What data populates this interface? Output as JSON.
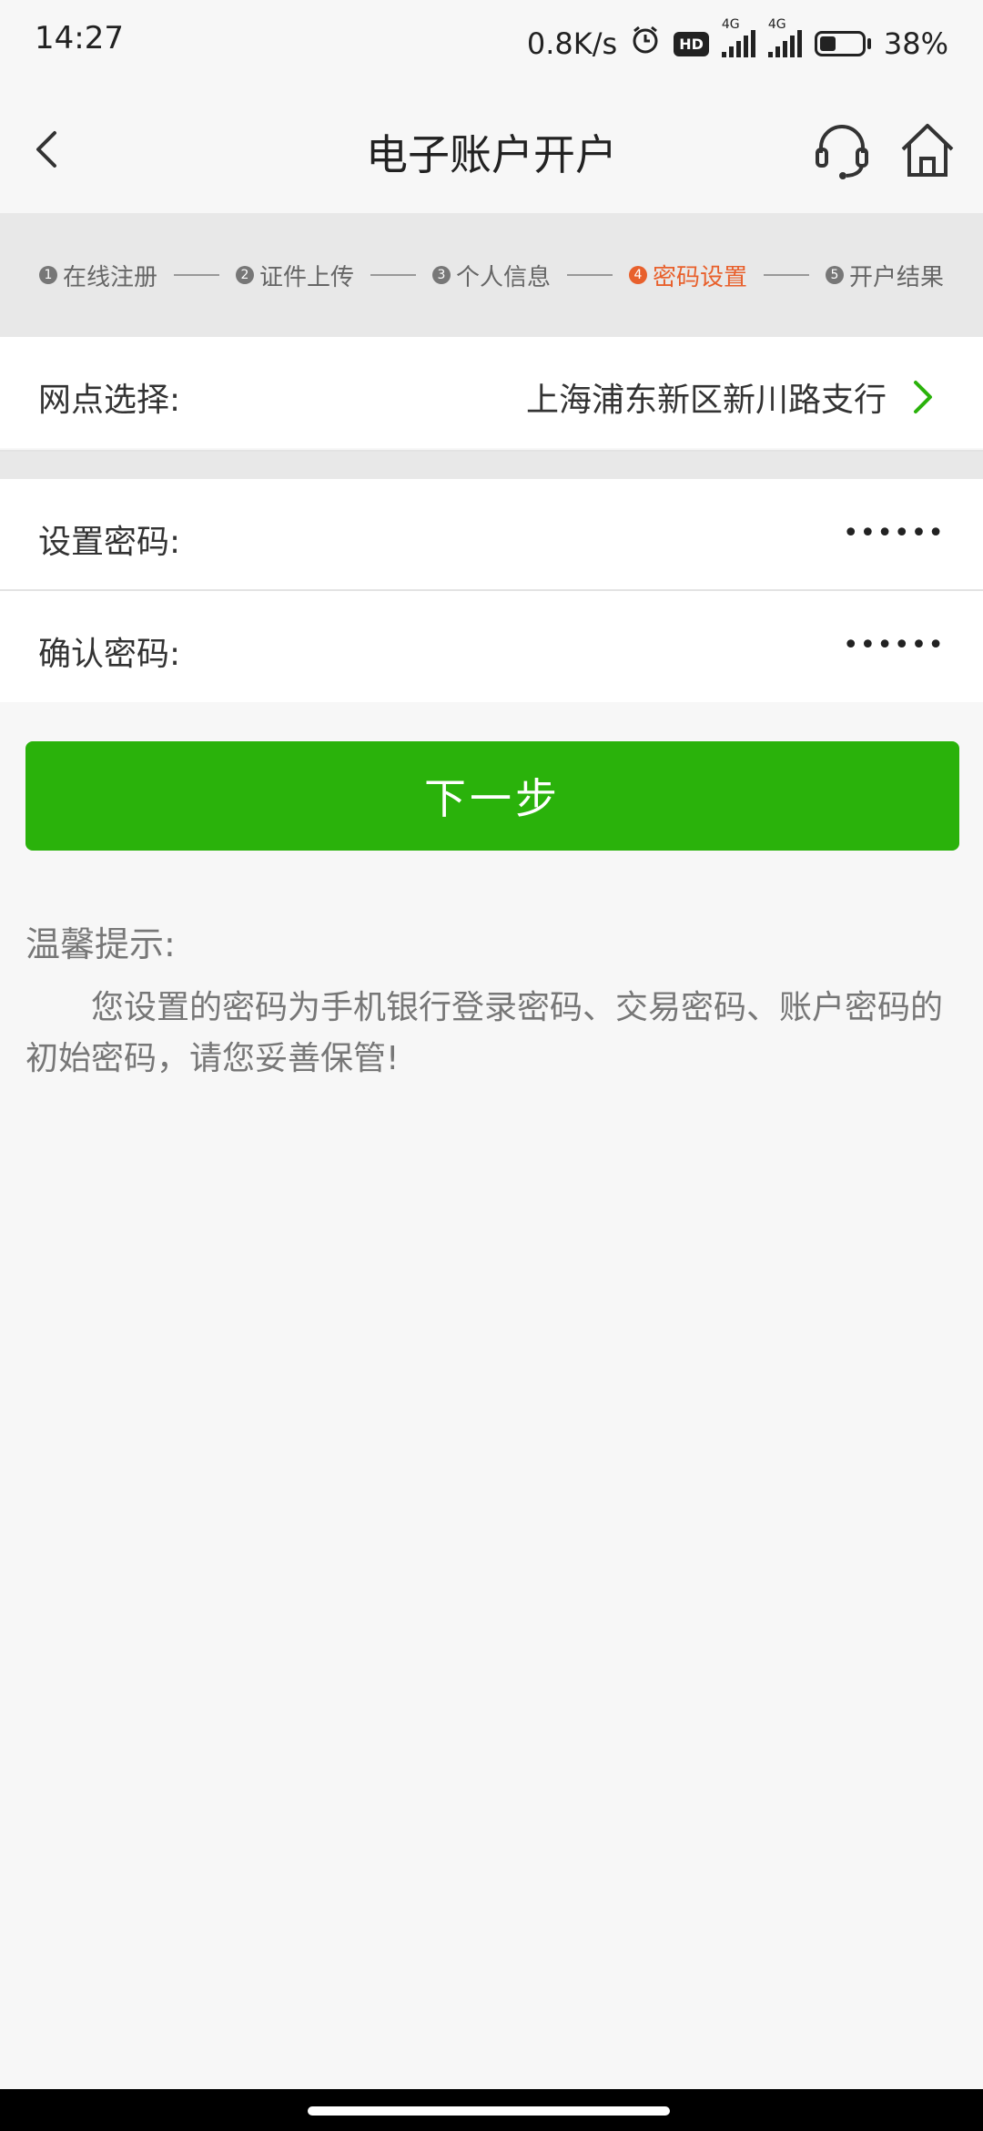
{
  "status_bar": {
    "time": "14:27",
    "net_speed": "0.8K/s",
    "hd": "HD",
    "sig1_tag": "4G",
    "sig2_tag": "4G",
    "battery_pct": "38%",
    "battery_level": 0.38
  },
  "header": {
    "title": "电子账户开户",
    "back_icon": "back-chevron-icon",
    "support_icon": "headset-icon",
    "home_icon": "home-icon"
  },
  "steps": [
    {
      "num": "1",
      "label": "在线注册",
      "active": false
    },
    {
      "num": "2",
      "label": "证件上传",
      "active": false
    },
    {
      "num": "3",
      "label": "个人信息",
      "active": false
    },
    {
      "num": "4",
      "label": "密码设置",
      "active": true
    },
    {
      "num": "5",
      "label": "开户结果",
      "active": false
    }
  ],
  "branch": {
    "label": "网点选择:",
    "value": "上海浦东新区新川路支行"
  },
  "password": {
    "label": "设置密码:",
    "value": "••••••"
  },
  "confirm": {
    "label": "确认密码:",
    "value": "••••••"
  },
  "next_button": "下一步",
  "tips": {
    "title": "温馨提示:",
    "body": "您设置的密码为手机银行登录密码、交易密码、账户密码的初始密码，请您妥善保管!"
  },
  "colors": {
    "accent_green": "#2ab20b",
    "active_step": "#e8602c"
  }
}
